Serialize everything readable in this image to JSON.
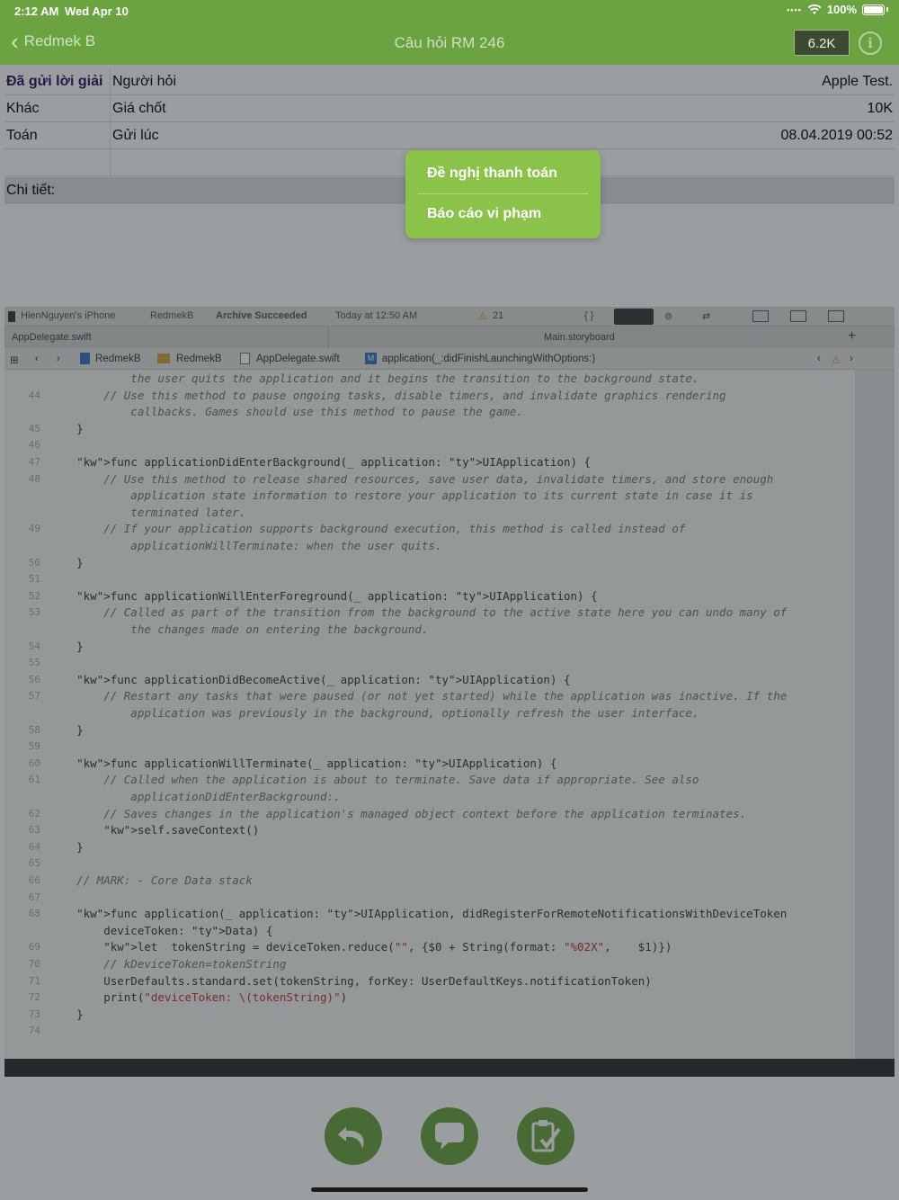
{
  "status_bar": {
    "time": "2:12 AM",
    "date": "Wed Apr 10",
    "battery": "100%"
  },
  "nav": {
    "back_label": "Redmek B",
    "title": "Câu hỏi RM 246",
    "score_badge": "6.2K",
    "info_icon": "info-icon"
  },
  "info_table": {
    "rows": [
      {
        "c1": "Đã gửi lời giải",
        "c2": "Người hỏi",
        "c3": "Apple Test."
      },
      {
        "c1": "Khác",
        "c2": "Giá chốt",
        "c3": "10K"
      },
      {
        "c1": "Toán",
        "c2": "Gửi lúc",
        "c3": "08.04.2019 00:52"
      }
    ],
    "detail_label": "Chi tiết:"
  },
  "popover": {
    "items": [
      "Đề nghị thanh toán",
      "Báo cáo vi phạm"
    ]
  },
  "photo": {
    "xcode_topbar": {
      "device": "HienNguyen's iPhone",
      "scheme": "RedmekB",
      "status": "Archive Succeeded",
      "time": "Today at 12:50 AM",
      "warnings": "21"
    },
    "tabs": {
      "left": "AppDelegate.swift",
      "right": "Main.storyboard"
    },
    "breadcrumb": [
      "RedmekB",
      "RedmekB",
      "AppDelegate.swift",
      "application(_:didFinishLaunchingWithOptions:)"
    ],
    "code_lines": [
      {
        "n": "",
        "t": "            the user quits the application and it begins the transition to the background state."
      },
      {
        "n": "44",
        "t": "        // Use this method to pause ongoing tasks, disable timers, and invalidate graphics rendering"
      },
      {
        "n": "",
        "t": "            callbacks. Games should use this method to pause the game."
      },
      {
        "n": "45",
        "t": "    }"
      },
      {
        "n": "46",
        "t": ""
      },
      {
        "n": "47",
        "t": "    func applicationDidEnterBackground(_ application: UIApplication) {"
      },
      {
        "n": "48",
        "t": "        // Use this method to release shared resources, save user data, invalidate timers, and store enough"
      },
      {
        "n": "",
        "t": "            application state information to restore your application to its current state in case it is"
      },
      {
        "n": "",
        "t": "            terminated later."
      },
      {
        "n": "49",
        "t": "        // If your application supports background execution, this method is called instead of"
      },
      {
        "n": "",
        "t": "            applicationWillTerminate: when the user quits."
      },
      {
        "n": "50",
        "t": "    }"
      },
      {
        "n": "51",
        "t": ""
      },
      {
        "n": "52",
        "t": "    func applicationWillEnterForeground(_ application: UIApplication) {"
      },
      {
        "n": "53",
        "t": "        // Called as part of the transition from the background to the active state here you can undo many of"
      },
      {
        "n": "",
        "t": "            the changes made on entering the background."
      },
      {
        "n": "54",
        "t": "    }"
      },
      {
        "n": "55",
        "t": ""
      },
      {
        "n": "56",
        "t": "    func applicationDidBecomeActive(_ application: UIApplication) {"
      },
      {
        "n": "57",
        "t": "        // Restart any tasks that were paused (or not yet started) while the application was inactive. If the"
      },
      {
        "n": "",
        "t": "            application was previously in the background, optionally refresh the user interface."
      },
      {
        "n": "58",
        "t": "    }"
      },
      {
        "n": "59",
        "t": ""
      },
      {
        "n": "60",
        "t": "    func applicationWillTerminate(_ application: UIApplication) {"
      },
      {
        "n": "61",
        "t": "        // Called when the application is about to terminate. Save data if appropriate. See also"
      },
      {
        "n": "",
        "t": "            applicationDidEnterBackground:."
      },
      {
        "n": "62",
        "t": "        // Saves changes in the application's managed object context before the application terminates."
      },
      {
        "n": "63",
        "t": "        self.saveContext()"
      },
      {
        "n": "64",
        "t": "    }"
      },
      {
        "n": "65",
        "t": ""
      },
      {
        "n": "66",
        "t": "    // MARK: - Core Data stack"
      },
      {
        "n": "67",
        "t": ""
      },
      {
        "n": "68",
        "t": "    func application(_ application: UIApplication, didRegisterForRemoteNotificationsWithDeviceToken"
      },
      {
        "n": "",
        "t": "        deviceToken: Data) {"
      },
      {
        "n": "69",
        "t": "        let  tokenString = deviceToken.reduce(\"\", {$0 + String(format: \"%02X\",    $1)})"
      },
      {
        "n": "70",
        "t": "        // kDeviceToken=tokenString"
      },
      {
        "n": "71",
        "t": "        UserDefaults.standard.set(tokenString, forKey: UserDefaultKeys.notificationToken)"
      },
      {
        "n": "72",
        "t": "        print(\"deviceToken: \\(tokenString)\")"
      },
      {
        "n": "73",
        "t": "    }"
      },
      {
        "n": "74",
        "t": ""
      }
    ]
  },
  "actions": [
    {
      "name": "undo-button",
      "icon": "undo-icon"
    },
    {
      "name": "comment-button",
      "icon": "speech-bubble-icon"
    },
    {
      "name": "submit-solution-button",
      "icon": "clipboard-check-icon"
    }
  ],
  "colors": {
    "brand_green": "#6aa33f",
    "popover_green": "#8bc34a"
  }
}
